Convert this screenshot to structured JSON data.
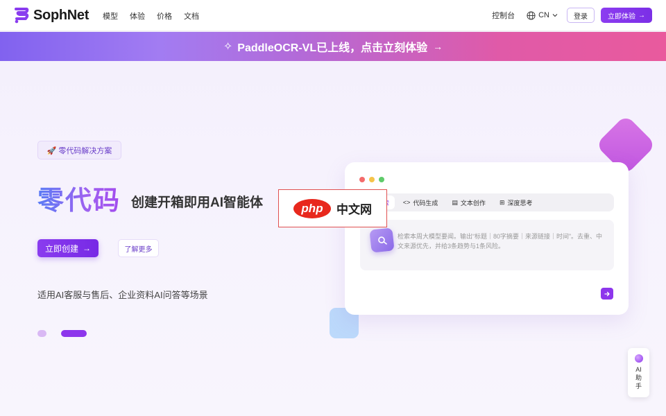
{
  "brand": {
    "name": "SophNet",
    "accent": "#8a3cef"
  },
  "nav": {
    "items": [
      "模型",
      "体验",
      "价格",
      "文档"
    ]
  },
  "header_right": {
    "console": "控制台",
    "language": "CN",
    "login": "登录",
    "try_now": "立即体验"
  },
  "banner": {
    "text": "PaddleOCR-VL已上线，点击立刻体验",
    "arrow": "→"
  },
  "hero": {
    "tag": "🚀 零代码解决方案",
    "title": "零代码",
    "subtitle": "创建开箱即用AI智能体",
    "cta": "立即创建",
    "learn_more": "了解更多",
    "description": "适用AI客服与售后、企业资料AI问答等场景"
  },
  "demo": {
    "window_dots": [
      "#f46b6b",
      "#f5c44a",
      "#5fcb6a"
    ],
    "tabs": [
      {
        "label": "搜索",
        "icon": "globe-icon",
        "active": true
      },
      {
        "label": "代码生成",
        "icon": "code-icon",
        "active": false
      },
      {
        "label": "文本创作",
        "icon": "document-icon",
        "active": false
      },
      {
        "label": "深度思考",
        "icon": "grid-icon",
        "active": false
      }
    ],
    "placeholder": "检索本周大模型要闻。输出“标题｜80字摘要｜来源链接｜时间”。去重、中文来源优先，并给3条趋势与1条风险。"
  },
  "watermark": {
    "logo": "php",
    "text": "中文网"
  },
  "ai_helper": {
    "label": "AI助手"
  }
}
